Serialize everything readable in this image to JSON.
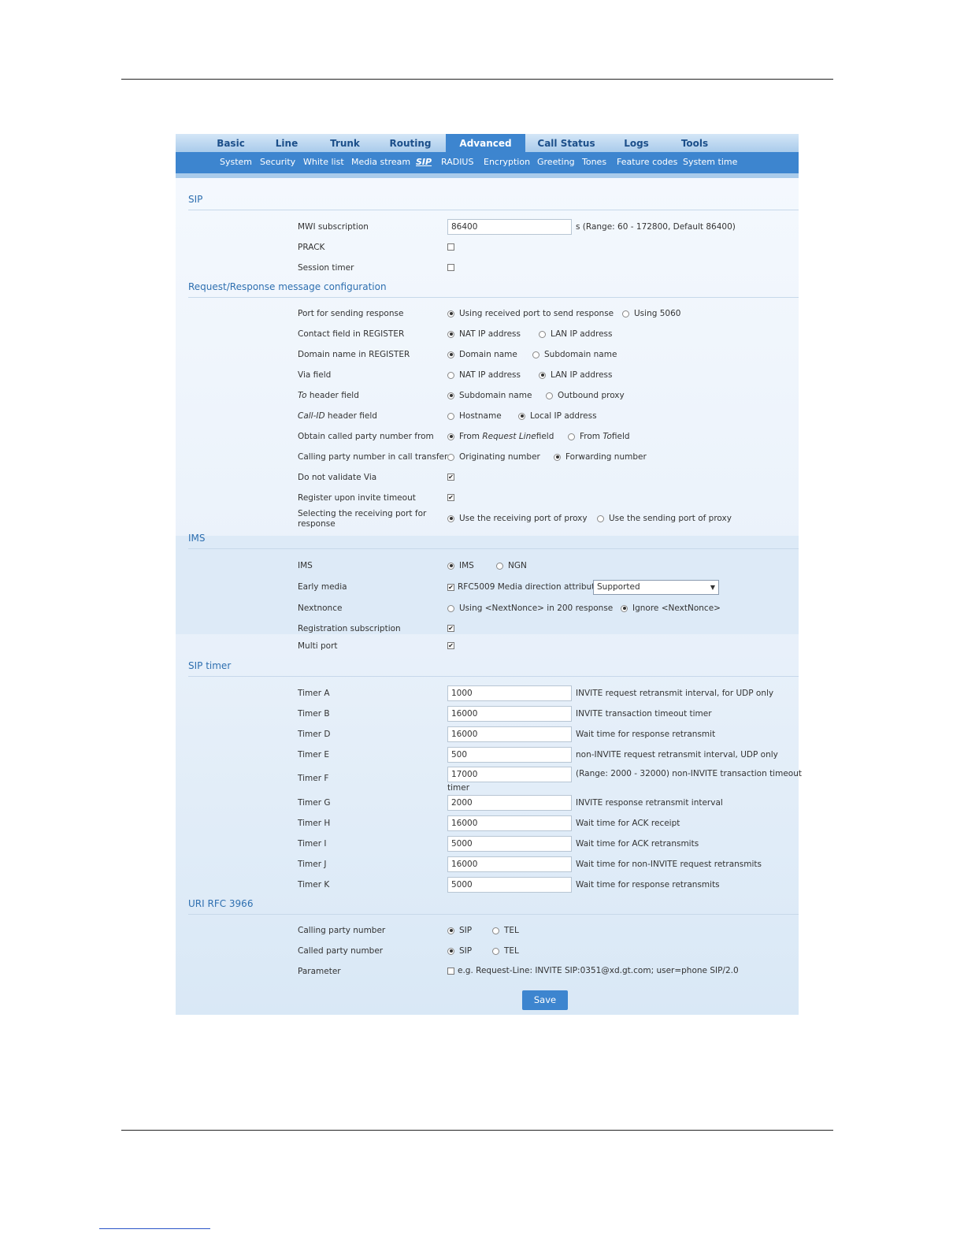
{
  "top_tabs": [
    "Basic",
    "Line",
    "Trunk",
    "Routing",
    "Advanced",
    "Call Status",
    "Logs",
    "Tools"
  ],
  "sub_tabs": [
    "System",
    "Security",
    "White list",
    "Media stream",
    "SIP",
    "RADIUS",
    "Encryption",
    "Greeting",
    "Tones",
    "Feature codes",
    "System time"
  ],
  "sections": {
    "sip": "SIP",
    "reqresp": "Request/Response message configuration",
    "ims": "IMS",
    "sip_timer": "SIP timer",
    "uri": "URI RFC 3966"
  },
  "sip": {
    "mwi_label": "MWI subscription",
    "mwi_value": "86400",
    "mwi_hint": "s (Range: 60 - 172800, Default 86400)",
    "prack_label": "PRACK",
    "session_timer_label": "Session timer"
  },
  "reqresp": {
    "port_label": "Port for sending response",
    "port_opt1": "Using received port to send response",
    "port_opt2": "Using 5060",
    "contact_label": "Contact field in REGISTER",
    "contact_opt1": "NAT IP address",
    "contact_opt2": "LAN IP address",
    "domain_label": "Domain name in REGISTER",
    "domain_opt1": "Domain name",
    "domain_opt2": "Subdomain name",
    "via_label": "Via field",
    "via_opt1": "NAT IP address",
    "via_opt2": "LAN IP address",
    "to_label_em": "To",
    "to_label_rest": " header field",
    "to_opt1": "Subdomain name",
    "to_opt2": "Outbound proxy",
    "callid_label_em": "Call-ID",
    "callid_label_rest": " header field",
    "callid_opt1": "Hostname",
    "callid_opt2": "Local IP address",
    "obtain_label": "Obtain called party number from",
    "obtain_opt1_pre": "From ",
    "obtain_opt1_em": "Request Line",
    "obtain_opt1_post": " field",
    "obtain_opt2_pre": "From ",
    "obtain_opt2_em": "To",
    "obtain_opt2_post": " field",
    "calling_label": "Calling party number in call transfer",
    "calling_opt1": "Originating number",
    "calling_opt2": "Forwarding number",
    "novalidate_label": "Do not validate Via",
    "register_timeout_label": "Register upon invite timeout",
    "selecting_label": "Selecting the receiving port for response",
    "selecting_opt1": "Use the receiving port of proxy",
    "selecting_opt2": "Use the sending port of proxy"
  },
  "ims": {
    "ims_label": "IMS",
    "ims_opt1": "IMS",
    "ims_opt2": "NGN",
    "early_label": "Early media",
    "early_check_label": "RFC5009 Media direction attribute",
    "early_select_value": "Supported",
    "nextnonce_label": "Nextnonce",
    "nextnonce_opt1": "Using <NextNonce> in 200 response",
    "nextnonce_opt2": "Ignore <NextNonce>",
    "regsub_label": "Registration subscription",
    "multiport_label": "Multi port"
  },
  "timers": [
    {
      "label": "Timer A",
      "value": "1000",
      "hint": "INVITE request retransmit interval, for UDP only"
    },
    {
      "label": "Timer B",
      "value": "16000",
      "hint": "INVITE transaction timeout timer"
    },
    {
      "label": "Timer D",
      "value": "16000",
      "hint": "Wait time for response retransmit"
    },
    {
      "label": "Timer E",
      "value": "500",
      "hint": "non-INVITE request retransmit interval, UDP only"
    },
    {
      "label": "Timer F",
      "value": "17000",
      "hint": "(Range: 2000 - 32000) non-INVITE transaction timeout",
      "hint2": "timer"
    },
    {
      "label": "Timer G",
      "value": "2000",
      "hint": "INVITE response retransmit interval"
    },
    {
      "label": "Timer H",
      "value": "16000",
      "hint": "Wait time for ACK receipt"
    },
    {
      "label": "Timer I",
      "value": "5000",
      "hint": "Wait time for ACK retransmits"
    },
    {
      "label": "Timer J",
      "value": "16000",
      "hint": "Wait time for non-INVITE request retransmits"
    },
    {
      "label": "Timer K",
      "value": "5000",
      "hint": "Wait time for response retransmits"
    }
  ],
  "uri": {
    "calling_label": "Calling party number",
    "calling_opt1": "SIP",
    "calling_opt2": "TEL",
    "called_label": "Called party number",
    "called_opt1": "SIP",
    "called_opt2": "TEL",
    "param_label": "Parameter",
    "param_hint": "e.g. Request-Line: INVITE SIP:0351@xd.gt.com; user=phone SIP/2.0"
  },
  "save_label": "Save",
  "colors": {
    "accent": "#3d85cf",
    "section_title": "#2e6fb0"
  }
}
